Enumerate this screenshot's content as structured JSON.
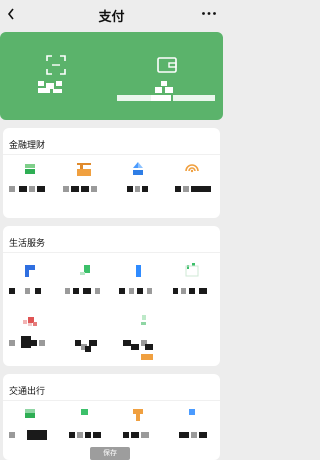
{
  "header": {
    "title": "支付"
  },
  "sections": [
    {
      "title": "金融理财"
    },
    {
      "title": "生活服务"
    },
    {
      "title": "交通出行"
    }
  ],
  "icons": {
    "back": "chevron-left-icon",
    "more": "more-icon",
    "scan": "scan-icon",
    "wallet": "wallet-icon"
  },
  "colors": {
    "accent": "#5bb36b",
    "background": "#ededed"
  },
  "footer": {
    "save_label": "保存"
  }
}
